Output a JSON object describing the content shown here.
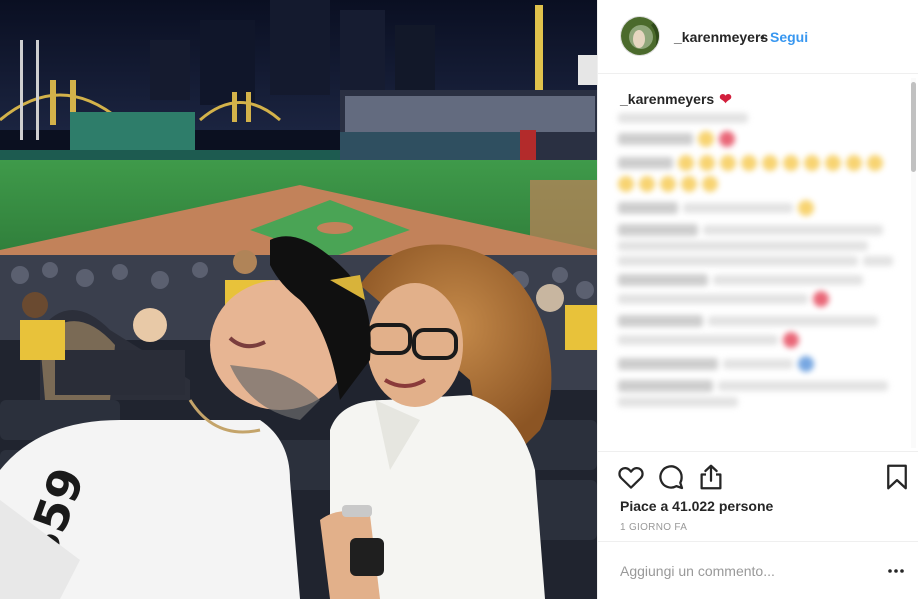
{
  "post": {
    "username": "_karenmeyers",
    "separator": "•",
    "follow_label": "Segui",
    "caption_user": "_karenmeyers",
    "caption_emoji": "heart-emoji",
    "likes_text": "Piace a 41.022 persone",
    "time_text": "1 GIORNO FA",
    "add_comment_placeholder": "Aggiungi un commento..."
  },
  "icons": {
    "like": "heart-outline-icon",
    "comment": "comment-bubble-icon",
    "share": "share-icon",
    "save": "bookmark-icon",
    "more": "more-options-icon"
  },
  "colors": {
    "follow_link": "#3897f0",
    "heart_emoji": "#d21f3c",
    "muted_text": "#999999",
    "divider": "#efefef"
  }
}
